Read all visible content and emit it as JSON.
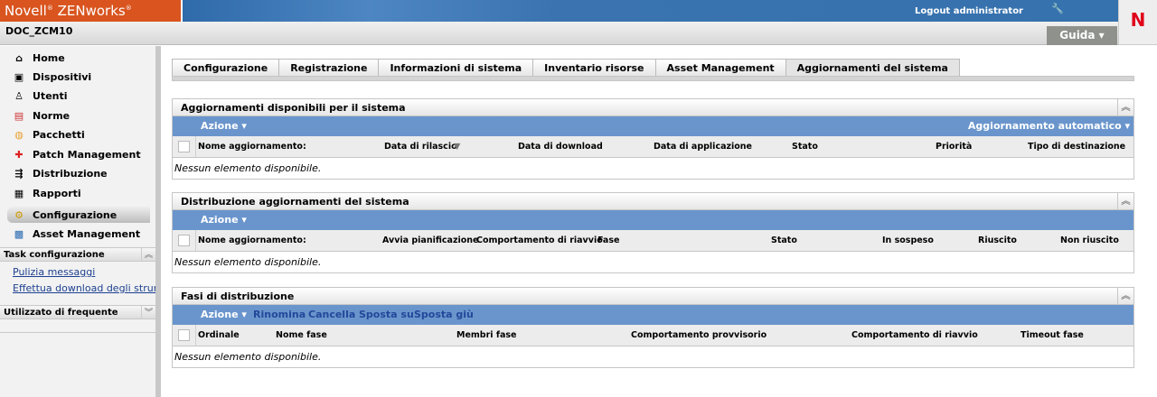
{
  "header": {
    "brand": "Novell",
    "brand_product": "ZENworks",
    "logout": "Logout administrator",
    "logo_letter": "N",
    "zone": "DOC_ZCM10",
    "help": "Guida ▾"
  },
  "sidebar": {
    "items": [
      {
        "label": "Home",
        "icon": "⌂"
      },
      {
        "label": "Dispositivi",
        "icon": "▣"
      },
      {
        "label": "Utenti",
        "icon": "♙"
      },
      {
        "label": "Norme",
        "icon": "▤"
      },
      {
        "label": "Pacchetti",
        "icon": "◍"
      },
      {
        "label": "Patch Management",
        "icon": "✚"
      },
      {
        "label": "Distribuzione",
        "icon": "⇶"
      },
      {
        "label": "Rapporti",
        "icon": "▦"
      },
      {
        "label": "Configurazione",
        "icon": "⚙"
      },
      {
        "label": "Asset Management",
        "icon": "▩"
      }
    ],
    "task_header": "Task configurazione",
    "task_links": [
      "Pulizia messaggi",
      "Effettua download degli strumenti"
    ],
    "frequent_header": "Utilizzato di frequente"
  },
  "tabs": [
    "Configurazione",
    "Registrazione",
    "Informazioni di sistema",
    "Inventario risorse",
    "Asset Management",
    "Aggiornamenti del sistema"
  ],
  "panels": [
    {
      "title": "Aggiornamenti disponibili per il sistema",
      "action": "Azione ▾",
      "right_action": "Aggiornamento automatico ▾",
      "columns": [
        "Nome aggiornamento:",
        "Data di rilascio",
        "Data di download",
        "Data di applicazione",
        "Stato",
        "Priorità",
        "Tipo di destinazione"
      ],
      "empty": "Nessun elemento disponibile."
    },
    {
      "title": "Distribuzione aggiornamenti del sistema",
      "action": "Azione ▾",
      "columns": [
        "Nome aggiornamento:",
        "Avvia pianificazione",
        "Comportamento di riavvio",
        "Fase",
        "Stato",
        "In sospeso",
        "Riuscito",
        "Non riuscito"
      ],
      "empty": "Nessun elemento disponibile."
    },
    {
      "title": "Fasi di distribuzione",
      "action": "Azione ▾",
      "links": [
        "Rinomina",
        "Cancella",
        "Sposta su",
        "Sposta giù"
      ],
      "columns": [
        "Ordinale",
        "Nome fase",
        "Membri fase",
        "Comportamento provvisorio",
        "Comportamento di riavvio",
        "Timeout fase"
      ],
      "empty": "Nessun elemento disponibile."
    }
  ]
}
